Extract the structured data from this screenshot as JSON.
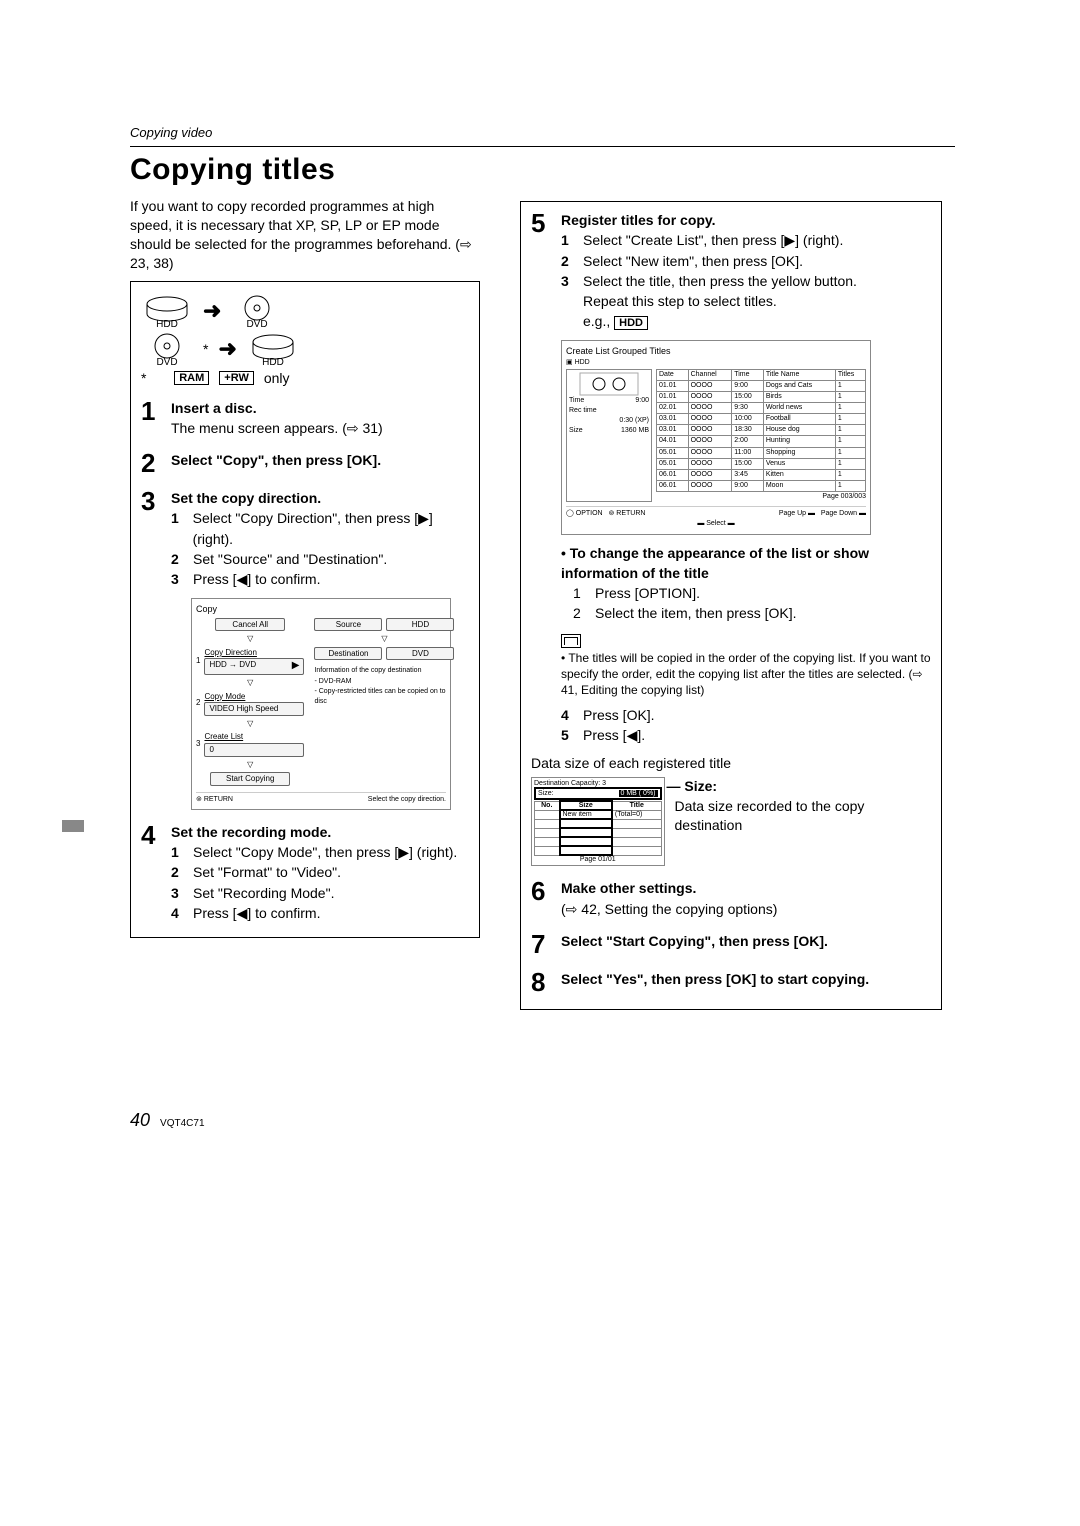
{
  "breadcrumb": "Copying video",
  "title": "Copying titles",
  "intro": "If you want to copy recorded programmes at high speed, it is necessary that XP, SP, LP or EP mode should be selected for the programmes beforehand. (⇨ 23, 38)",
  "media": {
    "hdd": "HDD",
    "dvd": "DVD",
    "asterisk": "*",
    "ram": "RAM",
    "rw": "+RW",
    "only": "only"
  },
  "steps": {
    "s1": {
      "h": "Insert a disc.",
      "t1": "The menu screen appears. (⇨ 31)"
    },
    "s2": {
      "h": "Select \"Copy\", then press [OK]."
    },
    "s3": {
      "h": "Set the copy direction.",
      "a": "Select \"Copy Direction\", then press [▶] (right).",
      "b": "Set \"Source\" and \"Destination\".",
      "c": "Press [◀] to confirm."
    },
    "s4": {
      "h": "Set the recording mode.",
      "a": "Select \"Copy Mode\", then press [▶] (right).",
      "b": "Set \"Format\" to \"Video\".",
      "c": "Set \"Recording Mode\".",
      "d": "Press [◀] to confirm."
    },
    "s5": {
      "h": "Register titles for copy.",
      "a": "Select \"Create List\", then press [▶] (right).",
      "b": "Select \"New item\", then press [OK].",
      "c": "Select the title, then press the yellow button.",
      "c2": "Repeat this step to select titles.",
      "eg": "e.g.,",
      "egtag": "HDD",
      "bullet1h": "To change the appearance of the list or show information of the title",
      "bullet1a": "Press [OPTION].",
      "bullet1b": "Select the item, then press [OK].",
      "note": "The titles will be copied in the order of the copying list. If you want to specify the order, edit the copying list after the titles are selected. (⇨ 41, Editing the copying list)",
      "d": "Press [OK].",
      "e": "Press [◀].",
      "dsize": "Data size of each registered title",
      "sizeLabel": "Size:",
      "sizeText": "Data size recorded to the copy destination"
    },
    "s6": {
      "h": "Make other settings.",
      "t1": "(⇨ 42, Setting the copying options)"
    },
    "s7": {
      "h": "Select \"Start Copying\", then press [OK]."
    },
    "s8": {
      "h": "Select \"Yes\", then press [OK] to start copying."
    }
  },
  "miniCopy": {
    "title": "Copy",
    "cancel": "Cancel All",
    "row1label": "Copy Direction",
    "row1val": "HDD → DVD",
    "row2label": "Copy Mode",
    "row2val": "VIDEO  High Speed",
    "row3label": "Create List",
    "row3val": "0",
    "start": "Start Copying",
    "src": "Source",
    "srcv": "HDD",
    "dst": "Destination",
    "dstv": "DVD",
    "info": "Information of the copy destination",
    "note1": "- DVD-RAM",
    "note2": "- Copy-restricted titles can be copied on to disc",
    "return": "RETURN",
    "hint": "Select the copy direction."
  },
  "miniList": {
    "title": "Create List  Grouped Titles",
    "hdd": "HDD",
    "left": {
      "timeL": "Time",
      "timeV": "9:00",
      "rectL": "Rec time",
      "rectV": "0:30 (XP)",
      "sizeL": "Size",
      "sizeV": "1360 MB"
    },
    "cols": [
      "Date",
      "Channel",
      "Time",
      "Title Name",
      "Titles"
    ],
    "rows": [
      [
        "01.01",
        "OOOO",
        "9:00",
        "Dogs and Cats",
        "1"
      ],
      [
        "01.01",
        "OOOO",
        "15:00",
        "Birds",
        "1"
      ],
      [
        "02.01",
        "OOOO",
        "9:30",
        "World news",
        "1"
      ],
      [
        "03.01",
        "OOOO",
        "10:00",
        "Football",
        "1"
      ],
      [
        "03.01",
        "OOOO",
        "18:30",
        "House dog",
        "1"
      ],
      [
        "04.01",
        "OOOO",
        "2:00",
        "Hunting",
        "1"
      ],
      [
        "05.01",
        "OOOO",
        "11:00",
        "Shopping",
        "1"
      ],
      [
        "05.01",
        "OOOO",
        "15:00",
        "Venus",
        "1"
      ],
      [
        "06.01",
        "OOOO",
        "3:45",
        "Kitten",
        "1"
      ],
      [
        "06.01",
        "OOOO",
        "9:00",
        "Moon",
        "1"
      ]
    ],
    "page": "Page 003/003",
    "option": "OPTION",
    "return": "RETURN",
    "pgup": "Page Up",
    "pgdn": "Page Down",
    "select": "Select"
  },
  "miniDest": {
    "header": "Destination Capacity:",
    "size": "Size:",
    "sizev": "0 MB ( 0%)",
    "cols": [
      "No.",
      "Size",
      "Title"
    ],
    "row1a": "New item",
    "row1b": "(Total=0)",
    "page": "Page 01/01"
  },
  "footer": {
    "pagenum": "40",
    "doc": "VQT4C71"
  }
}
